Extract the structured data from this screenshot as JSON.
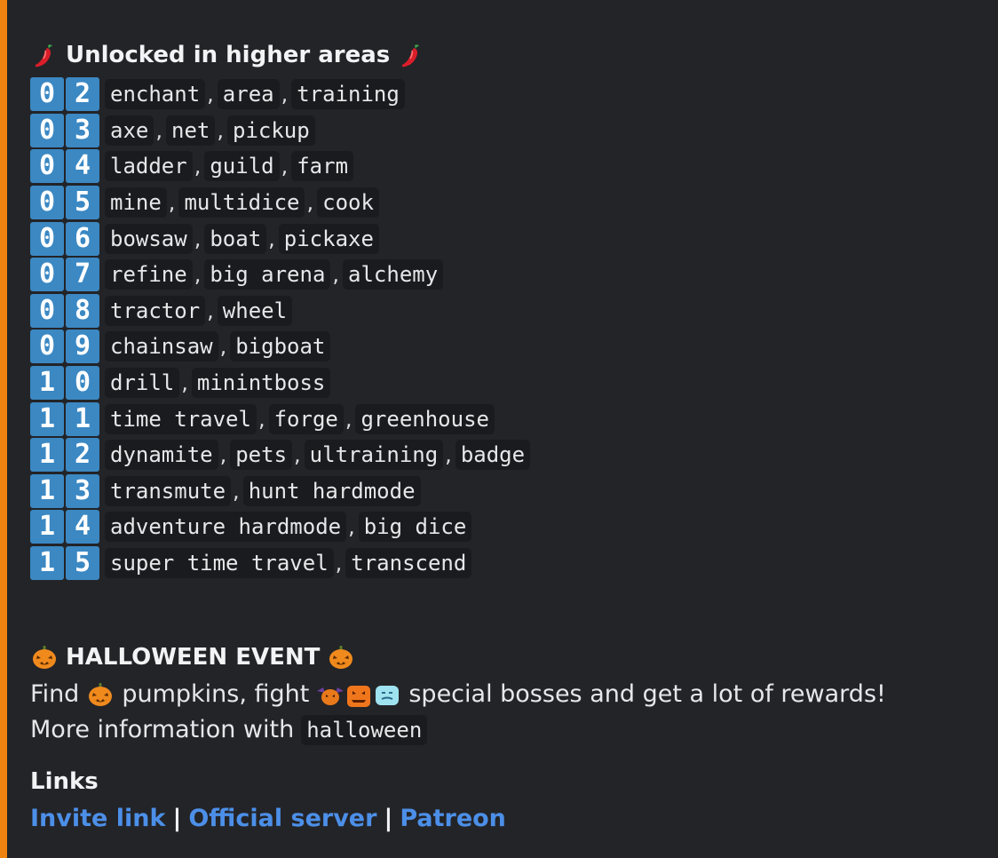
{
  "colors": {
    "accent_bar": "#f0820f",
    "digit_bg": "#3b88c3",
    "link": "#4c8fe8"
  },
  "unlocked": {
    "title": "Unlocked in higher areas",
    "icon": "red-chili-pepper-icon",
    "rows": [
      {
        "d1": "0",
        "d2": "2",
        "cmds": [
          "enchant",
          "area",
          "training"
        ]
      },
      {
        "d1": "0",
        "d2": "3",
        "cmds": [
          "axe",
          "net",
          "pickup"
        ]
      },
      {
        "d1": "0",
        "d2": "4",
        "cmds": [
          "ladder",
          "guild",
          "farm"
        ]
      },
      {
        "d1": "0",
        "d2": "5",
        "cmds": [
          "mine",
          "multidice",
          "cook"
        ]
      },
      {
        "d1": "0",
        "d2": "6",
        "cmds": [
          "bowsaw",
          "boat",
          "pickaxe"
        ]
      },
      {
        "d1": "0",
        "d2": "7",
        "cmds": [
          "refine",
          "big arena",
          "alchemy"
        ]
      },
      {
        "d1": "0",
        "d2": "8",
        "cmds": [
          "tractor",
          "wheel"
        ]
      },
      {
        "d1": "0",
        "d2": "9",
        "cmds": [
          "chainsaw",
          "bigboat"
        ]
      },
      {
        "d1": "1",
        "d2": "0",
        "cmds": [
          "drill",
          "minintboss"
        ]
      },
      {
        "d1": "1",
        "d2": "1",
        "cmds": [
          "time travel",
          "forge",
          "greenhouse"
        ]
      },
      {
        "d1": "1",
        "d2": "2",
        "cmds": [
          "dynamite",
          "pets",
          "ultraining",
          "badge"
        ]
      },
      {
        "d1": "1",
        "d2": "3",
        "cmds": [
          "transmute",
          "hunt hardmode"
        ]
      },
      {
        "d1": "1",
        "d2": "4",
        "cmds": [
          "adventure hardmode",
          "big dice"
        ]
      },
      {
        "d1": "1",
        "d2": "5",
        "cmds": [
          "super time travel",
          "transcend"
        ]
      }
    ]
  },
  "halloween": {
    "title": "HALLOWEEN EVENT",
    "icon": "jack-o-lantern-icon",
    "line1_a": "Find",
    "line1_b": "pumpkins, fight",
    "line1_c": "special bosses and get a lot of rewards!",
    "line2": "More information with",
    "command": "halloween",
    "boss_icons": [
      "pumpkin-bat-icon",
      "pumpkin-monster-icon",
      "ice-ghost-icon"
    ]
  },
  "links": {
    "title": "Links",
    "invite": "Invite link",
    "server": "Official server",
    "patreon": "Patreon",
    "separator": "|"
  }
}
